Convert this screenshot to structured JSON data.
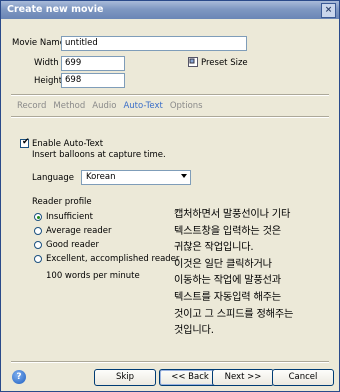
{
  "window": {
    "title": "Create new movie",
    "close_glyph": "×"
  },
  "movie": {
    "name_label": "Movie Name",
    "name_value": "untitled",
    "width_label": "Width",
    "width_value": "699",
    "height_label": "Height",
    "height_value": "698",
    "preset_label": "Preset Size",
    "preset_icon": "resize-icon"
  },
  "tabs": [
    {
      "label": "Record",
      "active": false
    },
    {
      "label": "Method",
      "active": false
    },
    {
      "label": "Audio",
      "active": false
    },
    {
      "label": "Auto-Text",
      "active": true
    },
    {
      "label": "Options",
      "active": false
    }
  ],
  "autotext": {
    "enable_label": "Enable Auto-Text",
    "enable_checked": true,
    "description": "Insert balloons at capture time.",
    "language_label": "Language",
    "language_value": "Korean",
    "reader_profile_label": "Reader profile",
    "reader_options": [
      {
        "label": "Insufficient",
        "selected": true
      },
      {
        "label": "Average reader",
        "selected": false
      },
      {
        "label": "Good reader",
        "selected": false
      },
      {
        "label": "Excellent, accomplished reader",
        "selected": false
      }
    ],
    "speed_text": "100 words per minute"
  },
  "annotation_lines": [
    "캡처하면서 말풍선이나 기타",
    "텍스트창을 입력하는 것은",
    "귀찮은 작업입니다.",
    "이것은 일단 클릭하거나",
    "이동하는 작업에 말풍선과",
    "텍스트를 자동입력 해주는",
    "것이고 그 스피드를 정해주는",
    "것입니다."
  ],
  "buttons": {
    "help_glyph": "?",
    "skip": "Skip",
    "back": "<< Back",
    "next": "Next >>",
    "cancel": "Cancel"
  }
}
